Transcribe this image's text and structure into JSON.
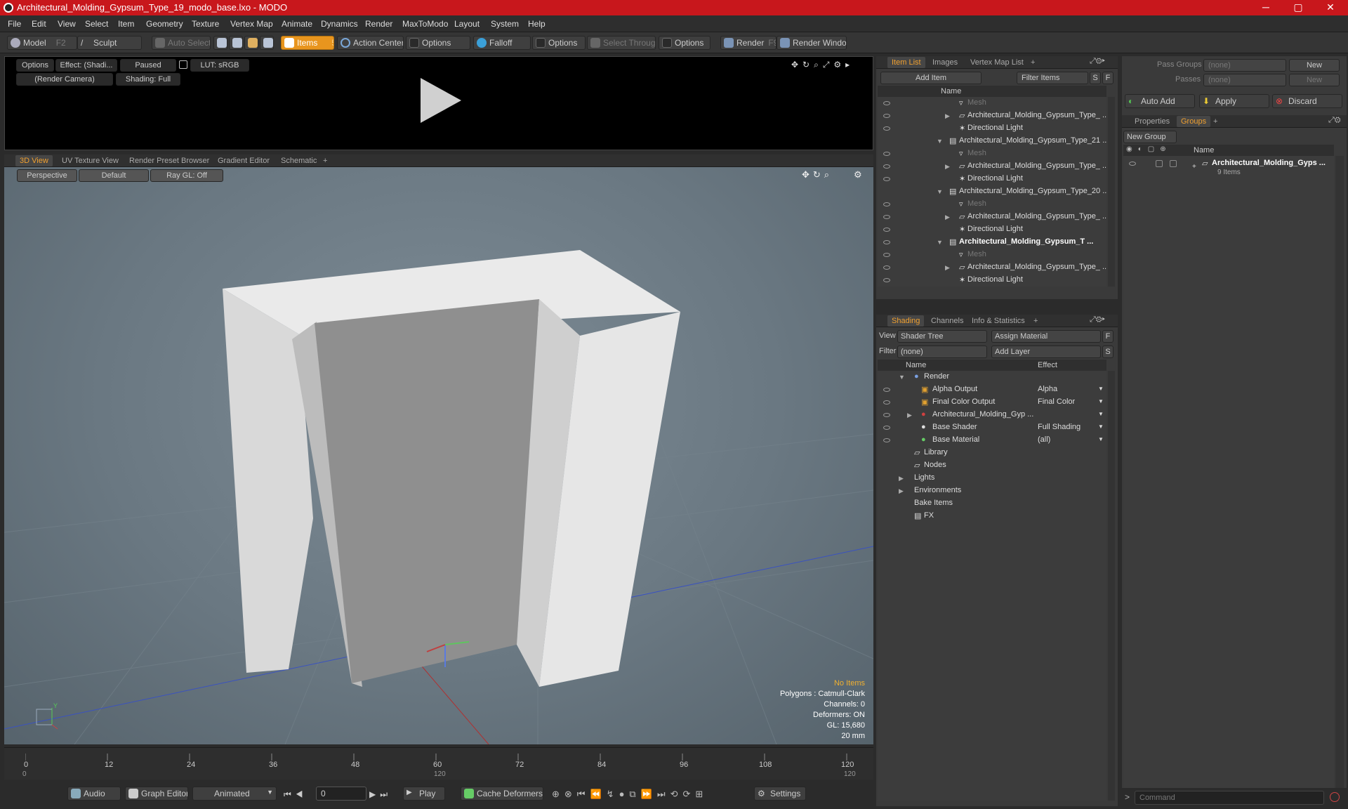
{
  "window": {
    "title": "Architectural_Molding_Gypsum_Type_19_modo_base.lxo - MODO",
    "minimize": "─",
    "maximize": "▢",
    "close": "✕"
  },
  "menu": [
    "File",
    "Edit",
    "View",
    "Select",
    "Item",
    "Geometry",
    "Texture",
    "Vertex Map",
    "Animate",
    "Dynamics",
    "Render",
    "MaxToModo",
    "Layout",
    "System",
    "Help"
  ],
  "toolbar": {
    "model": "Model",
    "model_key": "F2",
    "sculpt": "Sculpt",
    "auto_select": "Auto Select",
    "items": "Items",
    "items_key": "5",
    "action_center": "Action Center",
    "options": "Options",
    "falloff": "Falloff",
    "select_through": "Select Through",
    "render": "Render",
    "render_key": "F9",
    "render_window": "Render Window"
  },
  "preview": {
    "options": "Options",
    "effect": "Effect: (Shadi...",
    "paused": "Paused",
    "lut": "LUT: sRGB",
    "camera": "(Render Camera)",
    "shading": "Shading: Full"
  },
  "viewport_tabs": [
    "3D View",
    "UV Texture View",
    "Render Preset Browser",
    "Gradient Editor",
    "Schematic",
    "+"
  ],
  "viewport": {
    "perspective": "Perspective",
    "default": "Default",
    "raygl": "Ray GL: Off",
    "info": {
      "items": "No Items",
      "polygons": "Polygons : Catmull-Clark",
      "channels": "Channels: 0",
      "deformers": "Deformers: ON",
      "gl": "GL: 15,680",
      "unit": "20 mm"
    }
  },
  "timeline": {
    "ticks": [
      "0",
      "12",
      "24",
      "36",
      "48",
      "60",
      "72",
      "84",
      "96",
      "108",
      "120"
    ],
    "start": "0",
    "mid": "120",
    "end": "120"
  },
  "bottom": {
    "audio": "Audio",
    "graph_editor": "Graph Editor",
    "animated": "Animated",
    "frame": "0",
    "play": "Play",
    "cache": "Cache Deformers",
    "settings": "Settings"
  },
  "item_list": {
    "tabs": [
      "Item List",
      "Images",
      "Vertex Map List",
      "+"
    ],
    "add_item": "Add Item",
    "filter_items": "Filter Items",
    "s": "S",
    "f": "F",
    "name_header": "Name",
    "rows": [
      {
        "label": "Mesh",
        "indent": 3,
        "dim": true,
        "tri": ""
      },
      {
        "label": "Architectural_Molding_Gypsum_Type_ ...",
        "indent": 3,
        "dim": false,
        "tri": "▶"
      },
      {
        "label": "Directional Light",
        "indent": 3,
        "dim": false,
        "tri": ""
      },
      {
        "label": "Architectural_Molding_Gypsum_Type_21 ...",
        "indent": 2,
        "dim": false,
        "tri": "▼"
      },
      {
        "label": "Mesh",
        "indent": 3,
        "dim": true,
        "tri": ""
      },
      {
        "label": "Architectural_Molding_Gypsum_Type_ ...",
        "indent": 3,
        "dim": false,
        "tri": "▶"
      },
      {
        "label": "Directional Light",
        "indent": 3,
        "dim": false,
        "tri": ""
      },
      {
        "label": "Architectural_Molding_Gypsum_Type_20 ...",
        "indent": 2,
        "dim": false,
        "tri": "▼"
      },
      {
        "label": "Mesh",
        "indent": 3,
        "dim": true,
        "tri": ""
      },
      {
        "label": "Architectural_Molding_Gypsum_Type_ ...",
        "indent": 3,
        "dim": false,
        "tri": "▶"
      },
      {
        "label": "Directional Light",
        "indent": 3,
        "dim": false,
        "tri": ""
      },
      {
        "label": "Architectural_Molding_Gypsum_T ...",
        "indent": 2,
        "dim": false,
        "tri": "▼",
        "bold": true
      },
      {
        "label": "Mesh",
        "indent": 3,
        "dim": true,
        "tri": ""
      },
      {
        "label": "Architectural_Molding_Gypsum_Type_ ...",
        "indent": 3,
        "dim": false,
        "tri": "▶"
      },
      {
        "label": "Directional Light",
        "indent": 3,
        "dim": false,
        "tri": ""
      }
    ]
  },
  "shading": {
    "tabs": [
      "Shading",
      "Channels",
      "Info & Statistics",
      "+"
    ],
    "view_label": "View",
    "view_value": "Shader Tree",
    "assign_material": "Assign Material",
    "filter_label": "Filter",
    "filter_value": "(none)",
    "add_layer": "Add Layer",
    "f": "F",
    "s": "S",
    "name_header": "Name",
    "effect_header": "Effect",
    "rows": [
      {
        "label": "Render",
        "effect": "",
        "indent": 1,
        "tri": "▼"
      },
      {
        "label": "Alpha Output",
        "effect": "Alpha",
        "indent": 2,
        "tri": ""
      },
      {
        "label": "Final Color Output",
        "effect": "Final Color",
        "indent": 2,
        "tri": ""
      },
      {
        "label": "Architectural_Molding_Gyp ...",
        "effect": "",
        "indent": 2,
        "tri": "▶"
      },
      {
        "label": "Base Shader",
        "effect": "Full Shading",
        "indent": 2,
        "tri": ""
      },
      {
        "label": "Base Material",
        "effect": "(all)",
        "indent": 2,
        "tri": ""
      },
      {
        "label": "Library",
        "effect": "",
        "indent": 2,
        "tri": ""
      },
      {
        "label": "Nodes",
        "effect": "",
        "indent": 2,
        "tri": ""
      },
      {
        "label": "Lights",
        "effect": "",
        "indent": 1,
        "tri": "▶"
      },
      {
        "label": "Environments",
        "effect": "",
        "indent": 1,
        "tri": "▶"
      },
      {
        "label": "Bake Items",
        "effect": "",
        "indent": 1,
        "tri": ""
      },
      {
        "label": "FX",
        "effect": "",
        "indent": 2,
        "tri": ""
      }
    ]
  },
  "right": {
    "pass_groups": "Pass Groups",
    "passes": "Passes",
    "none": "(none)",
    "new": "New",
    "auto_add": "Auto Add",
    "apply": "Apply",
    "discard": "Discard",
    "tabs": [
      "Properties",
      "Groups",
      "+"
    ],
    "new_group": "New Group",
    "name_header": "Name",
    "group_name": "Architectural_Molding_Gyps ...",
    "group_count": "9 Items",
    "command": "Command"
  }
}
